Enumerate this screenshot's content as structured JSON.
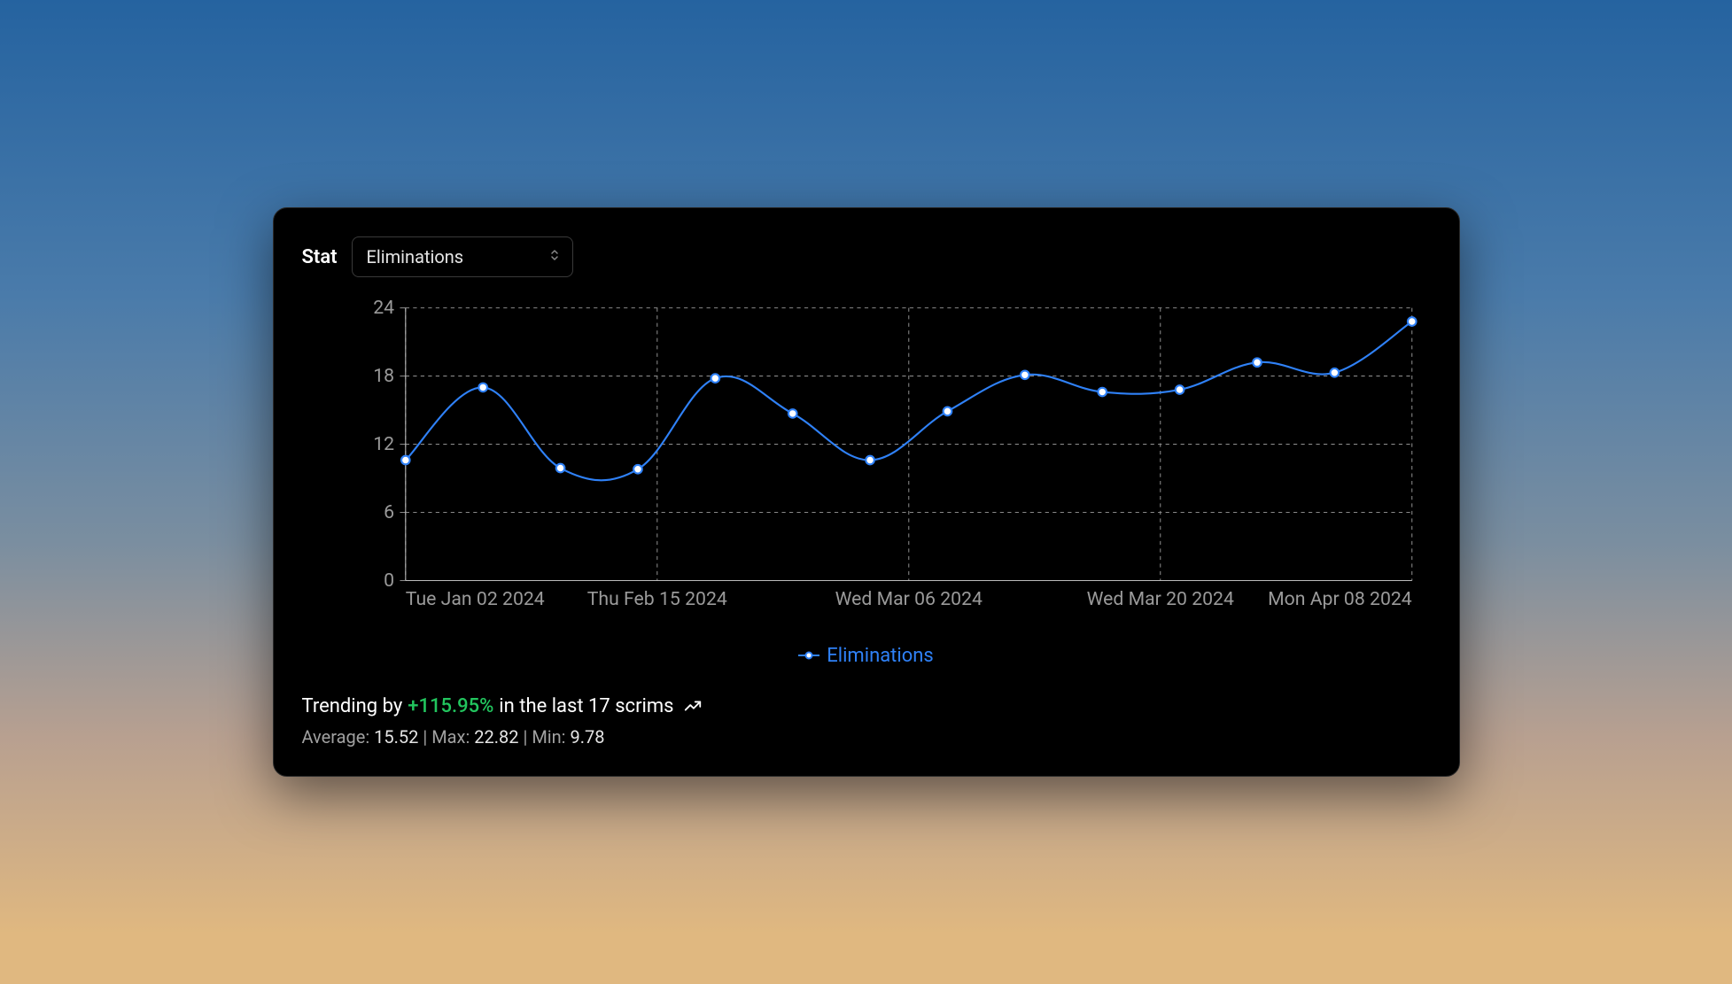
{
  "header": {
    "stat_label": "Stat",
    "selected_stat": "Eliminations"
  },
  "legend": {
    "label": "Eliminations"
  },
  "summary": {
    "trending_prefix": "Trending by",
    "trending_pct": "+115.95%",
    "trending_suffix": "in the last 17 scrims",
    "avg_label": "Average:",
    "avg_value": "15.52",
    "max_label": "Max:",
    "max_value": "22.82",
    "min_label": "Min:",
    "min_value": "9.78",
    "separator": " | "
  },
  "chart_data": {
    "type": "line",
    "title": "",
    "xlabel": "",
    "ylabel": "",
    "ylim": [
      0,
      24
    ],
    "y_ticks": [
      0,
      6,
      12,
      18,
      24
    ],
    "x_tick_labels": [
      "Tue Jan 02 2024",
      "Thu Feb 15 2024",
      "Wed Mar 06 2024",
      "Wed Mar 20 2024",
      "Mon Apr 08 2024"
    ],
    "legend_entries": [
      "Eliminations"
    ],
    "series": [
      {
        "name": "Eliminations",
        "color": "#2f81f7",
        "values": [
          10.6,
          17.0,
          9.9,
          9.8,
          17.8,
          14.7,
          10.6,
          14.9,
          18.1,
          16.6,
          16.8,
          19.2,
          18.3,
          22.8
        ]
      }
    ]
  }
}
